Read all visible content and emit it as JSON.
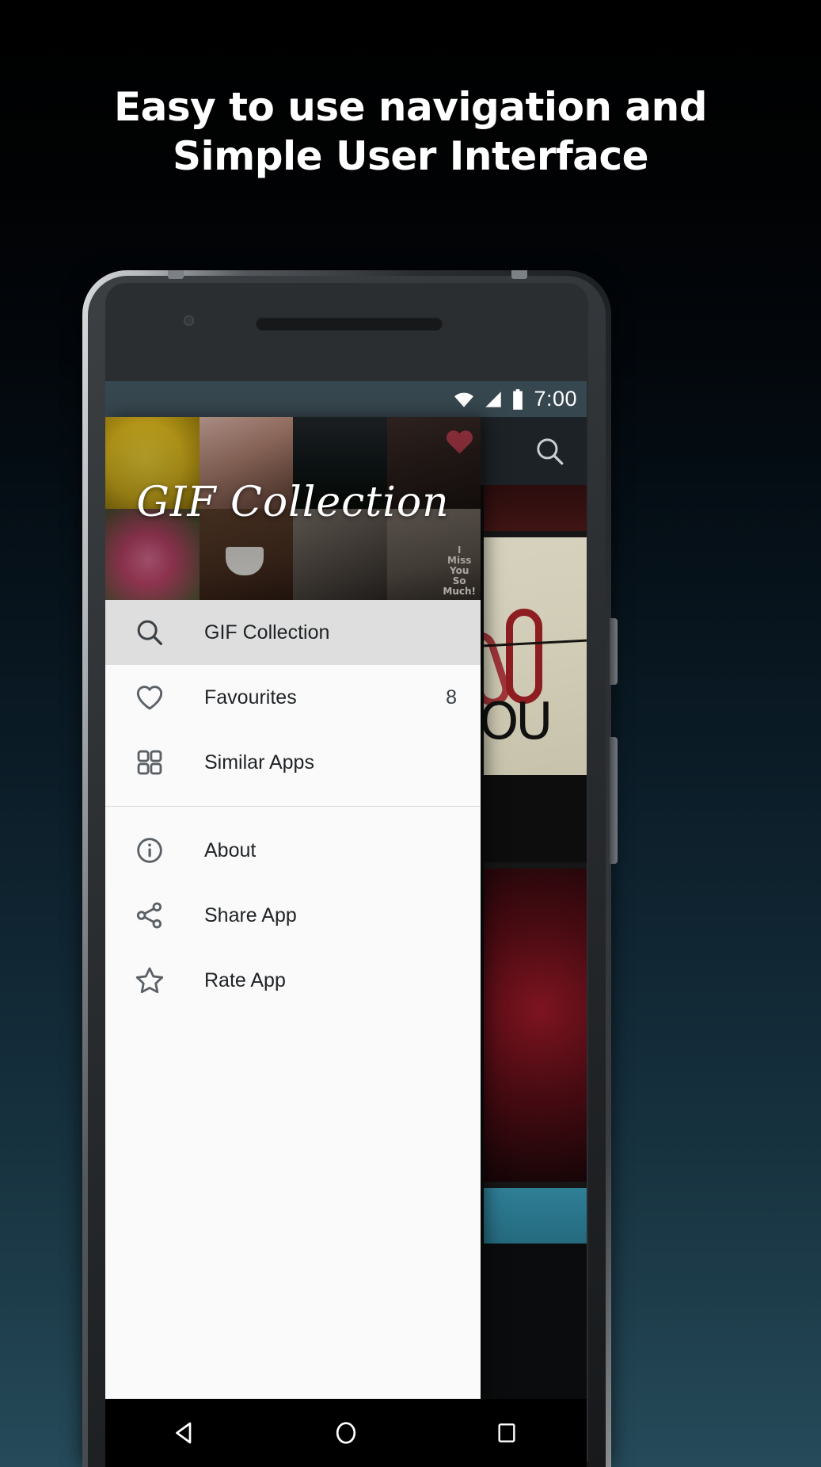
{
  "promo": {
    "headline_line1": "Easy to use navigation and",
    "headline_line2": "Simple User Interface"
  },
  "statusbar": {
    "time": "7:00",
    "wifi_icon": "wifi-icon",
    "signal_icon": "cellular-signal-icon",
    "battery_icon": "battery-full-icon"
  },
  "appbar": {
    "search_icon": "search-icon"
  },
  "drawer": {
    "header_title": "GIF Collection",
    "collage": [
      {
        "name": "emoji-wink-thumbnail"
      },
      {
        "name": "holding-hands-thumbnail"
      },
      {
        "name": "night-trees-thumbnail"
      },
      {
        "name": "heart-wood-thumbnail"
      },
      {
        "name": "pink-flower-thumbnail"
      },
      {
        "name": "coffee-cup-thumbnail"
      },
      {
        "name": "wooden-fence-thumbnail"
      },
      {
        "name": "i-miss-you-thumbnail"
      }
    ],
    "miss_text_line1": "I",
    "miss_text_line2": "Miss",
    "miss_text_line3": "You",
    "miss_text_line4": "So",
    "miss_text_line5": "Much!",
    "items_primary": [
      {
        "label": "GIF Collection",
        "icon": "search-icon",
        "badge": "",
        "selected": true
      },
      {
        "label": "Favourites",
        "icon": "heart-icon",
        "badge": "8",
        "selected": false
      },
      {
        "label": "Similar Apps",
        "icon": "grid-apps-icon",
        "badge": "",
        "selected": false
      }
    ],
    "items_secondary": [
      {
        "label": "About",
        "icon": "info-circle-icon",
        "badge": "",
        "selected": false
      },
      {
        "label": "Share App",
        "icon": "share-nodes-icon",
        "badge": "",
        "selected": false
      },
      {
        "label": "Rate App",
        "icon": "star-outline-icon",
        "badge": "",
        "selected": false
      }
    ]
  },
  "navbar": {
    "back_icon": "back-triangle-icon",
    "home_icon": "home-circle-icon",
    "recents_icon": "recents-square-icon"
  },
  "colors": {
    "statusbar_bg": "#37474f",
    "drawer_bg": "#fafafa",
    "selected_item_bg": "#dedede",
    "text_primary": "#1f2326",
    "page_bottom": "#264a5a"
  }
}
